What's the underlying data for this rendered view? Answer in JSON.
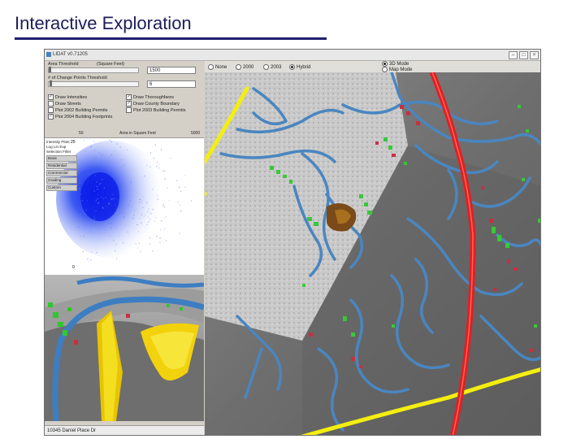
{
  "slide": {
    "title": "Interactive Exploration"
  },
  "window": {
    "title": "LIDAT v0.71205",
    "minimize_glyph": "–",
    "maximize_glyph": "□",
    "close_glyph": "×"
  },
  "controls": {
    "area_threshold_label": "Area Threshold",
    "area_unit_label": "(Square Feet)",
    "area_threshold_value": "1500",
    "change_points_label": "# of Change Points Threshold",
    "change_points_value": "6",
    "checkboxes_left": [
      {
        "label": "Draw Intensities",
        "checked": true
      },
      {
        "label": "Draw Streets",
        "checked": false
      },
      {
        "label": "Plot 2002 Building Permits",
        "checked": false
      },
      {
        "label": "Plot 2004 Building Footprints",
        "checked": true
      }
    ],
    "checkboxes_right": [
      {
        "label": "Draw Thoroughfares",
        "checked": true
      },
      {
        "label": "Draw County Boundary",
        "checked": true
      },
      {
        "label": "Plot 2003 Building Permits",
        "checked": false
      }
    ]
  },
  "density_header": {
    "left": "50",
    "center": "Area in Square Feet",
    "right": "5000"
  },
  "density_panel": {
    "intensity_label": "Intensity Plots",
    "scale_buttons": [
      "Log",
      "Lin",
      "Exp"
    ],
    "selection_label": "Selection Filter",
    "filters": [
      "Basic",
      "Residential",
      "Commercial",
      "Grading",
      "Custom"
    ],
    "top_tick": "25",
    "bottom_tick": "0"
  },
  "map_toolbar": {
    "year_options": [
      {
        "label": "None",
        "selected": false
      },
      {
        "label": "2000",
        "selected": false
      },
      {
        "label": "2003",
        "selected": false
      },
      {
        "label": "Hybrid",
        "selected": true
      }
    ],
    "mode_options": [
      {
        "label": "3D Mode",
        "selected": true
      },
      {
        "label": "Map Mode",
        "selected": false
      }
    ]
  },
  "statusbar": {
    "text": "10345 Daniel Place Dr"
  },
  "colors": {
    "streets": "#4a86c0",
    "highway": "#e02020",
    "thoroughfare": "#f4ee10",
    "footprints": "#38c838",
    "permits": "#c83040",
    "intensity": "#1a3cf0"
  }
}
